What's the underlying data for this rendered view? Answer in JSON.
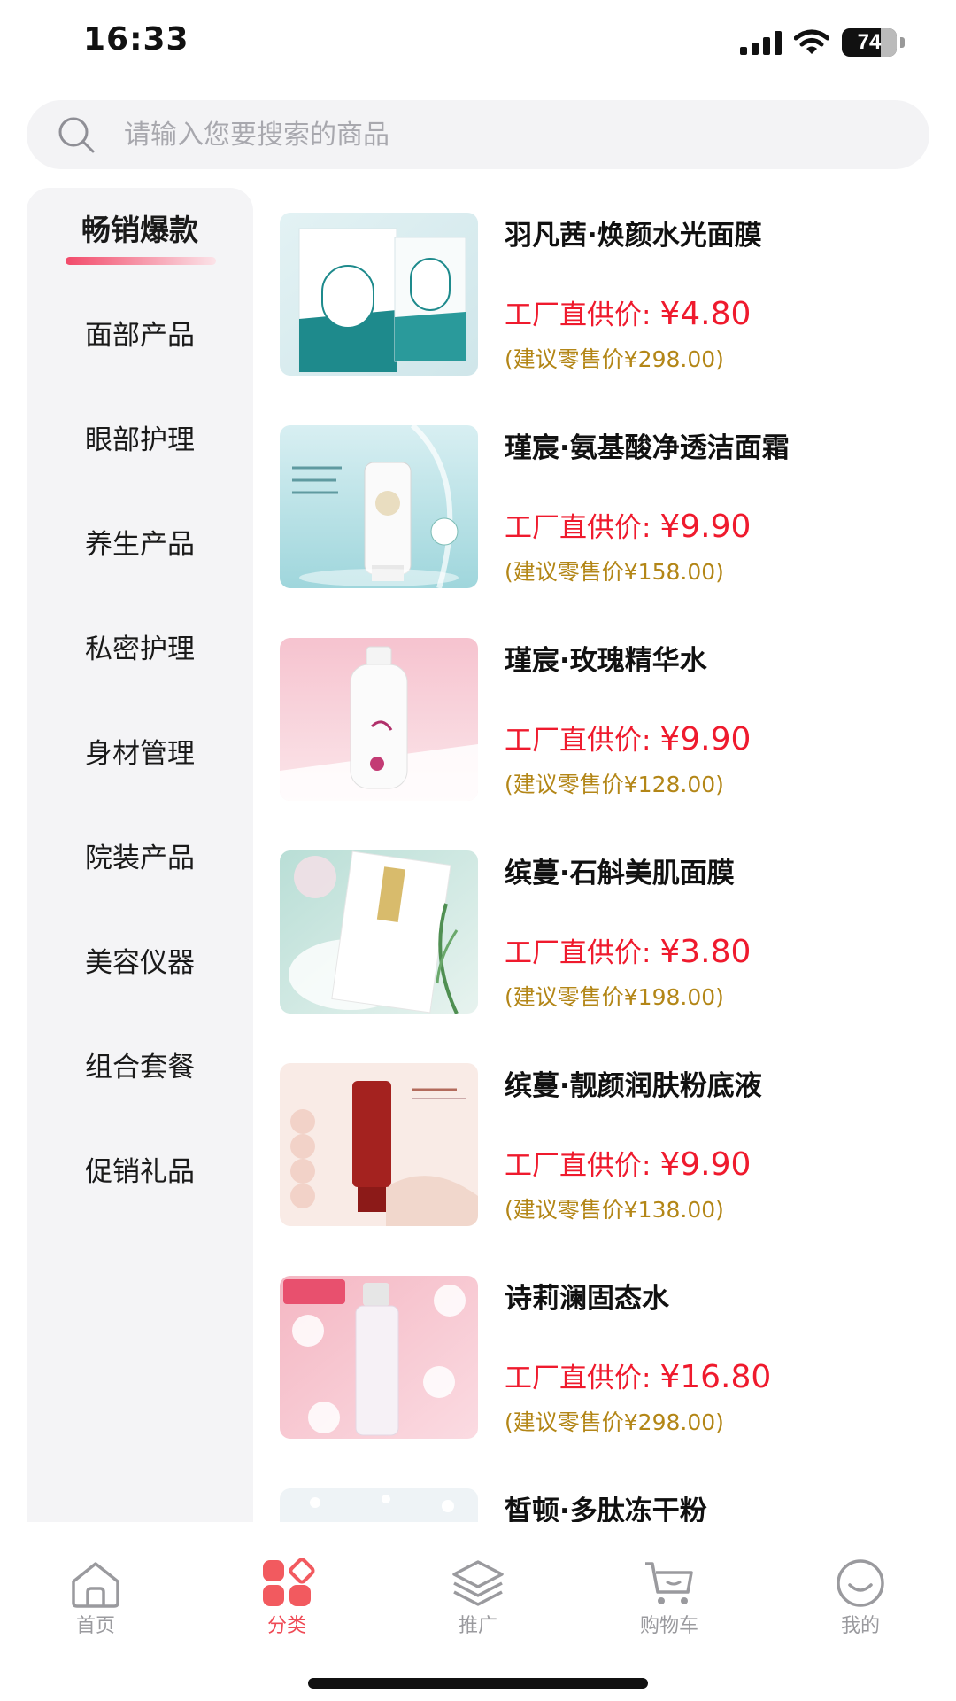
{
  "status": {
    "time": "16:33",
    "battery": "74"
  },
  "search": {
    "placeholder": "请输入您要搜索的商品"
  },
  "sidebar": {
    "items": [
      {
        "label": "畅销爆款",
        "active": true
      },
      {
        "label": "面部产品"
      },
      {
        "label": "眼部护理"
      },
      {
        "label": "养生产品"
      },
      {
        "label": "私密护理"
      },
      {
        "label": "身材管理"
      },
      {
        "label": "院装产品"
      },
      {
        "label": "美容仪器"
      },
      {
        "label": "组合套餐"
      },
      {
        "label": "促销礼品"
      }
    ]
  },
  "price_label": "工厂直供价: ",
  "products": [
    {
      "name": "羽凡茜·焕颜水光面膜",
      "price": "¥4.80",
      "retail": "(建议零售价¥298.00)",
      "image": "mask-box-teal"
    },
    {
      "name": "瑾宸·氨基酸净透洁面霜",
      "price": "¥9.90",
      "retail": "(建议零售价¥158.00)",
      "image": "cleanser-tube-water"
    },
    {
      "name": "瑾宸·玫瑰精华水",
      "price": "¥9.90",
      "retail": "(建议零售价¥128.00)",
      "image": "toner-bottle-pink"
    },
    {
      "name": "缤蔓·石斛美肌面膜",
      "price": "¥3.80",
      "retail": "(建议零售价¥198.00)",
      "image": "mask-sheet-green"
    },
    {
      "name": "缤蔓·靓颜润肤粉底液",
      "price": "¥9.90",
      "retail": "(建议零售价¥138.00)",
      "image": "foundation-tube-red"
    },
    {
      "name": "诗莉澜固态水",
      "price": "¥16.80",
      "retail": "(建议零售价¥298.00)",
      "image": "spray-bottle-pink"
    },
    {
      "name": "皙顿·多肽冻干粉",
      "price": "",
      "retail": "",
      "image": "powder-partial"
    }
  ],
  "nav": {
    "items": [
      {
        "label": "首页",
        "icon": "home-icon"
      },
      {
        "label": "分类",
        "icon": "category-icon",
        "active": true
      },
      {
        "label": "推广",
        "icon": "layers-icon"
      },
      {
        "label": "购物车",
        "icon": "cart-icon"
      },
      {
        "label": "我的",
        "icon": "smiley-icon"
      }
    ]
  },
  "colors": {
    "accent": "#ef4a55",
    "price": "#ef1a2d",
    "retail": "#b38617",
    "sidebar_bg": "#f4f4f6"
  }
}
